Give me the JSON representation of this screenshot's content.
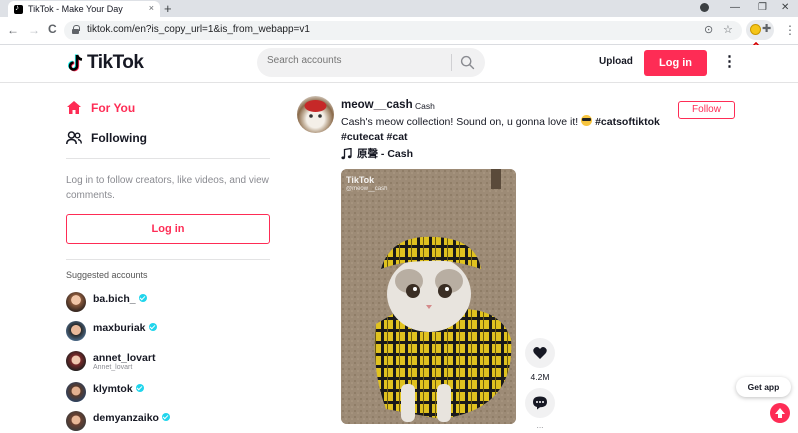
{
  "browser": {
    "tab_title": "TikTok - Make Your Day",
    "tab_close": "×",
    "new_tab": "+",
    "url": "tiktok.com/en?is_copy_url=1&is_from_webapp=v1",
    "back": "←",
    "forward": "→",
    "reload": "C",
    "minimize": "—",
    "maximize": "❐",
    "close": "✕",
    "menu": "⋮",
    "icons": [
      "lock-icon",
      "install-app-icon",
      "bookmark-star-icon",
      "extension-icon",
      "puzzle-icon"
    ]
  },
  "header": {
    "logo_text": "TikTok",
    "search_placeholder": "Search accounts",
    "upload_label": "Upload",
    "login_label": "Log in",
    "more": "⋮"
  },
  "sidebar": {
    "nav": [
      {
        "label": "For You",
        "icon": "home-icon",
        "active": true
      },
      {
        "label": "Following",
        "icon": "following-icon",
        "active": false
      }
    ],
    "login_prompt": "Log in to follow creators, like videos, and view comments.",
    "login_label": "Log in",
    "suggested_title": "Suggested accounts",
    "accounts": [
      {
        "name": "ba.bich_",
        "verified": true,
        "sub": ""
      },
      {
        "name": "maxburiak",
        "verified": true,
        "sub": ""
      },
      {
        "name": "annet_lovart",
        "verified": false,
        "sub": "Annet_lovart"
      },
      {
        "name": "klymtok",
        "verified": true,
        "sub": ""
      },
      {
        "name": "demyanzaiko",
        "verified": true,
        "sub": ""
      }
    ]
  },
  "post": {
    "username": "meow__cash",
    "nickname": "Cash",
    "caption_text": "Cash's meow collection! Sound on, u gonna love it!",
    "caption_tag1": "#catsoftiktok",
    "caption_tag2": "#cutecat",
    "caption_tag3": "#cat",
    "music": "原聲 - Cash",
    "follow_label": "Follow",
    "watermark": "TikTok",
    "watermark_handle": "@meow__cash",
    "likes": "4.2M",
    "comments": "..."
  },
  "floating": {
    "get_app": "Get app"
  },
  "colors": {
    "brand": "#fe2c55",
    "verified": "#20d5ec",
    "annotation": "#d40000"
  }
}
